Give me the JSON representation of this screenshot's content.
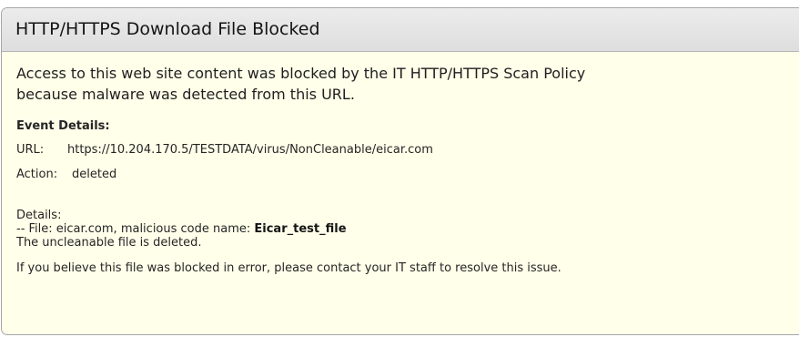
{
  "header": {
    "title": "HTTP/HTTPS Download File Blocked"
  },
  "intro": {
    "line1": "Access to this web site content was blocked by the IT HTTP/HTTPS Scan Policy",
    "line2": "because malware was detected from this URL."
  },
  "event": {
    "heading": "Event Details:",
    "url_label": "URL:",
    "url_value": "https://10.204.170.5/TESTDATA/virus/NonCleanable/eicar.com",
    "action_label": "Action:",
    "action_value": "deleted"
  },
  "details": {
    "heading": "Details:",
    "file_prefix": "-- File: eicar.com, malicious code name: ",
    "malware_name": "Eicar_test_file",
    "result": "The uncleanable file is deleted."
  },
  "footer": {
    "note": "If you believe this file was blocked in error, please contact your IT staff to resolve this issue."
  },
  "colors": {
    "panel_background": "#ffffea",
    "header_background": "#e5e5e5",
    "border": "#a6a6a6",
    "text": "#222222"
  }
}
